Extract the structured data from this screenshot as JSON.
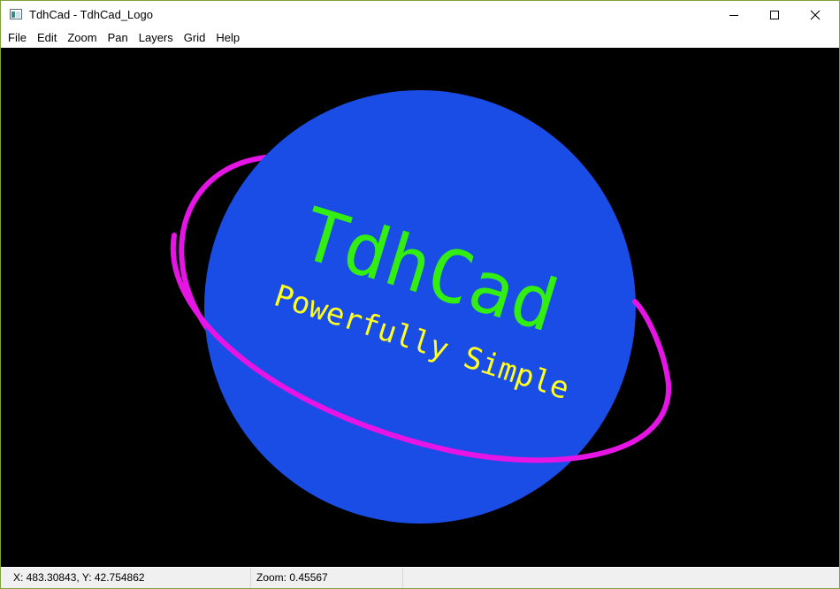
{
  "window": {
    "title": "TdhCad - TdhCad_Logo"
  },
  "menu": [
    "File",
    "Edit",
    "Zoom",
    "Pan",
    "Layers",
    "Grid",
    "Help"
  ],
  "logo": {
    "title_text": "TdhCad",
    "tagline": "Powerfully Simple",
    "colors": {
      "background": "#000000",
      "planet": "#1a4ce6",
      "ring": "#e615e6",
      "title": "#33ee11",
      "tagline": "#ffff22"
    }
  },
  "status": {
    "coords": "X: 483.30843, Y: 42.754862",
    "zoom": "Zoom: 0.45567"
  },
  "icons": {
    "app": "app-icon",
    "minimize": "minimize-icon",
    "maximize": "maximize-icon",
    "close": "close-icon"
  }
}
